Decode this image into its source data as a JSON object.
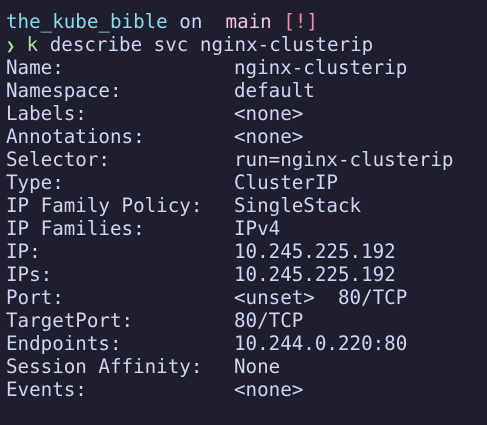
{
  "prompt": {
    "directory": "the_kube_bible",
    "on": "on",
    "branch_icon": "",
    "branch": "main",
    "status": "[!]",
    "chevron": "❯"
  },
  "command": {
    "binary": "k",
    "args": "describe svc nginx-clusterip"
  },
  "output": [
    {
      "key": "Name:",
      "value": "nginx-clusterip"
    },
    {
      "key": "Namespace:",
      "value": "default"
    },
    {
      "key": "Labels:",
      "value": "<none>"
    },
    {
      "key": "Annotations:",
      "value": "<none>"
    },
    {
      "key": "Selector:",
      "value": "run=nginx-clusterip"
    },
    {
      "key": "Type:",
      "value": "ClusterIP"
    },
    {
      "key": "IP Family Policy:",
      "value": "SingleStack"
    },
    {
      "key": "IP Families:",
      "value": "IPv4"
    },
    {
      "key": "IP:",
      "value": "10.245.225.192"
    },
    {
      "key": "IPs:",
      "value": "10.245.225.192"
    },
    {
      "key": "Port:",
      "value": "<unset>  80/TCP"
    },
    {
      "key": "TargetPort:",
      "value": "80/TCP"
    },
    {
      "key": "Endpoints:",
      "value": "10.244.0.220:80"
    },
    {
      "key": "Session Affinity:",
      "value": "None"
    },
    {
      "key": "Events:",
      "value": "<none>"
    }
  ]
}
